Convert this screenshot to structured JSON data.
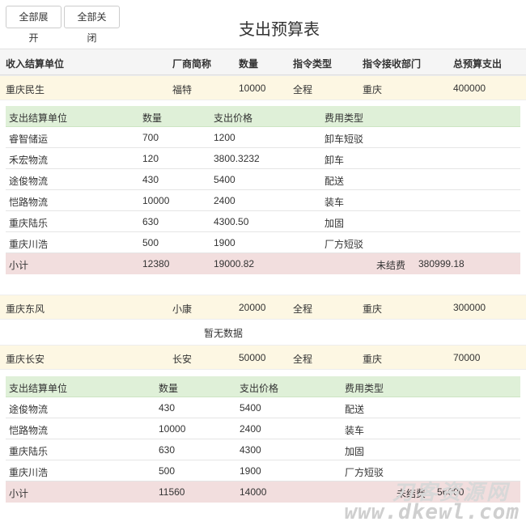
{
  "toolbar": {
    "expand_all": "全部展开",
    "collapse_all": "全部关闭"
  },
  "page": {
    "title": "支出预算表"
  },
  "main_columns": [
    "收入结算单位",
    "厂商简称",
    "数量",
    "指令类型",
    "指令接收部门",
    "总预算支出"
  ],
  "groups": [
    {
      "unit": "重庆民生",
      "vendor": "福特",
      "qty": "10000",
      "order_type": "全程",
      "dept": "重庆",
      "total": "400000",
      "sub_columns": [
        "支出结算单位",
        "数量",
        "支出价格",
        "费用类型"
      ],
      "items": [
        {
          "unit": "睿智储运",
          "qty": "700",
          "price": "1200",
          "fee_type": "卸车短驳"
        },
        {
          "unit": "禾宏物流",
          "qty": "120",
          "price": "3800.3232",
          "fee_type": "卸车"
        },
        {
          "unit": "途俊物流",
          "qty": "430",
          "price": "5400",
          "fee_type": "配送"
        },
        {
          "unit": "恺路物流",
          "qty": "10000",
          "price": "2400",
          "fee_type": "装车"
        },
        {
          "unit": "重庆陆乐",
          "qty": "630",
          "price": "4300.50",
          "fee_type": "加固"
        },
        {
          "unit": "重庆川浩",
          "qty": "500",
          "price": "1900",
          "fee_type": "厂方短驳"
        }
      ],
      "subtotal": {
        "label": "小计",
        "qty": "12380",
        "price": "19000.82",
        "unsettled_label": "未结费",
        "unsettled": "380999.18"
      }
    },
    {
      "unit": "重庆东风",
      "vendor": "小康",
      "qty": "20000",
      "order_type": "全程",
      "dept": "重庆",
      "total": "300000",
      "empty_text": "暂无数据"
    },
    {
      "unit": "重庆长安",
      "vendor": "长安",
      "qty": "50000",
      "order_type": "全程",
      "dept": "重庆",
      "total": "70000",
      "sub_columns": [
        "支出结算单位",
        "数量",
        "支出价格",
        "费用类型"
      ],
      "items": [
        {
          "unit": "途俊物流",
          "qty": "430",
          "price": "5400",
          "fee_type": "配送"
        },
        {
          "unit": "恺路物流",
          "qty": "10000",
          "price": "2400",
          "fee_type": "装车"
        },
        {
          "unit": "重庆陆乐",
          "qty": "630",
          "price": "4300",
          "fee_type": "加固"
        },
        {
          "unit": "重庆川浩",
          "qty": "500",
          "price": "1900",
          "fee_type": "厂方短驳"
        }
      ],
      "subtotal": {
        "label": "小计",
        "qty": "11560",
        "price": "14000",
        "unsettled_label": "未结费",
        "unsettled": "56000"
      }
    }
  ],
  "watermark": {
    "line1": "刀客资源网",
    "line2": "www.dkewl.com"
  }
}
